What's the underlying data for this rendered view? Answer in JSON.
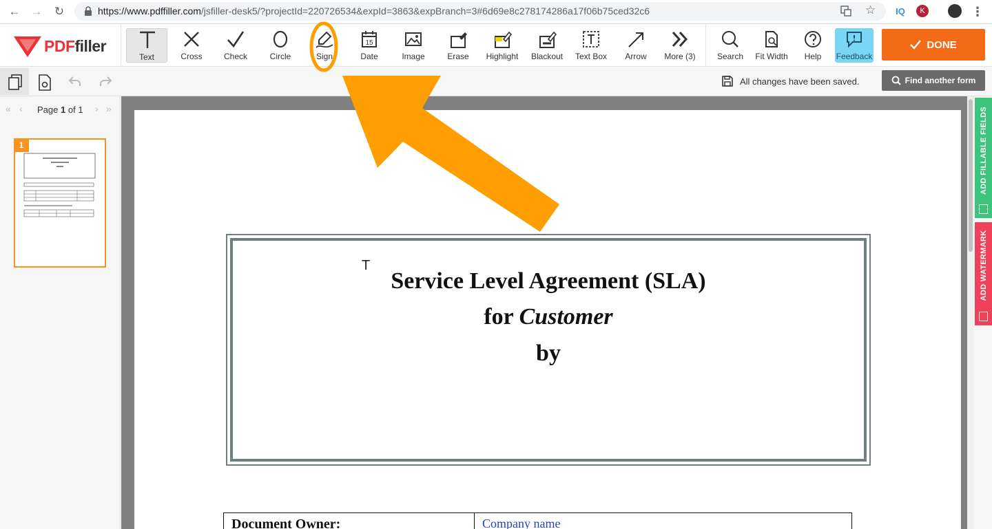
{
  "browser": {
    "url_host": "https://www.pdffiller.com",
    "url_path": "/jsfiller-desk5/?projectId=220726534&expId=3863&expBranch=3#6d69e8c278174286a17f06b75ced32c6",
    "extension_label": "IQ",
    "avatar_letter": "K"
  },
  "logo": {
    "pdf": "PDF",
    "filler": "filler"
  },
  "toolbar": {
    "tools": [
      {
        "label": "Text"
      },
      {
        "label": "Cross"
      },
      {
        "label": "Check"
      },
      {
        "label": "Circle"
      },
      {
        "label": "Sign"
      },
      {
        "label": "Date"
      },
      {
        "label": "Image"
      },
      {
        "label": "Erase"
      },
      {
        "label": "Highlight"
      },
      {
        "label": "Blackout"
      },
      {
        "label": "Text Box"
      },
      {
        "label": "Arrow"
      },
      {
        "label": "More (3)"
      },
      {
        "label": "Search"
      },
      {
        "label": "Fit Width"
      },
      {
        "label": "Help"
      },
      {
        "label": "Feedback"
      }
    ],
    "done_label": "DONE",
    "date_icon_number": "15"
  },
  "subbar": {
    "save_status": "All changes have been saved.",
    "find_form_label": "Find another form"
  },
  "sidebar": {
    "page_word": "Page",
    "page_current": "1",
    "page_of": "of 1",
    "thumb_number": "1"
  },
  "document": {
    "cursor_glyph": "T",
    "title_line1": "Service Level Agreement (SLA)",
    "title_line2_prefix": "for ",
    "title_line2_italic": "Customer",
    "title_line3": "by",
    "table_label": "Document Owner:",
    "table_value": "Company name"
  },
  "right_rail": {
    "fillable_label": "ADD FILLABLE FIELDS",
    "watermark_label": "ADD WATERMARK"
  },
  "colors": {
    "done": "#f36b16",
    "highlight_annotation": "#ff9e00",
    "fillable_tab": "#3cc47c",
    "watermark_tab": "#f0415a",
    "feedback": "#7ad6f5"
  }
}
